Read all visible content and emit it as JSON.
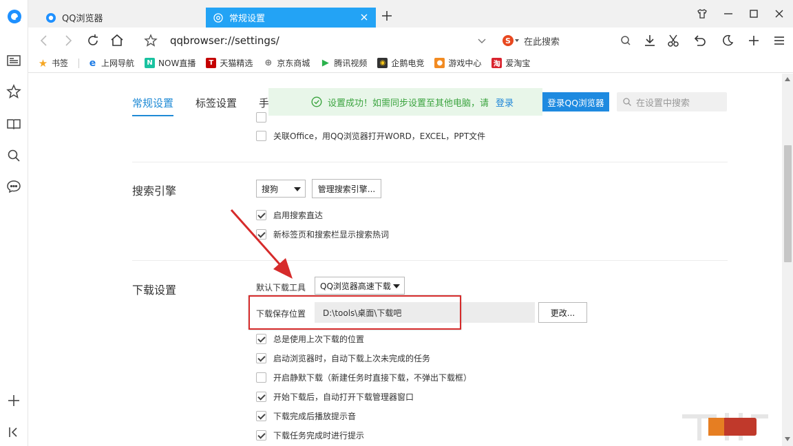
{
  "tabs": {
    "inactive": {
      "title": "QQ浏览器"
    },
    "active": {
      "title": "常规设置"
    }
  },
  "toolbar": {
    "url": "qqbrowser://settings/",
    "search_placeholder": "在此搜索"
  },
  "bookmarks": [
    {
      "label": "书签",
      "icon": "star-icon",
      "color": "#f5a623"
    },
    {
      "label": "上网导航",
      "icon": "ie-e-icon",
      "color": "#1d7be5"
    },
    {
      "label": "NOW直播",
      "icon": "now-icon",
      "color": "#19c2a0"
    },
    {
      "label": "天猫精选",
      "icon": "tmall-icon",
      "color": "#c40000"
    },
    {
      "label": "京东商城",
      "icon": "globe-icon",
      "color": "#777777"
    },
    {
      "label": "腾讯视频",
      "icon": "play-icon",
      "color": "#2bb24c"
    },
    {
      "label": "企鹅电竞",
      "icon": "penguin-icon",
      "color": "#333333"
    },
    {
      "label": "游戏中心",
      "icon": "gamepad-icon",
      "color": "#f28b22"
    },
    {
      "label": "爱淘宝",
      "icon": "taobao-icon",
      "color": "#d9232e"
    }
  ],
  "settings": {
    "tabs": [
      "常规设置",
      "标签设置",
      "手"
    ],
    "toast": {
      "message": "设置成功！如需同步设置至其他电脑，请",
      "link": "登录"
    },
    "login_button": "登录QQ浏览器",
    "search_placeholder": "在设置中搜索",
    "office_option": "关联Office，用QQ浏览器打开WORD，EXCEL，PPT文件",
    "search_engine": {
      "title": "搜索引擎",
      "selected": "搜狗",
      "manage_button": "管理搜索引擎...",
      "options": [
        "启用搜索直达",
        "新标签页和搜索栏显示搜索热词"
      ]
    },
    "download": {
      "title": "下载设置",
      "default_tool_label": "默认下载工具",
      "default_tool_value": "QQ浏览器高速下载",
      "save_location_label": "下载保存位置",
      "save_location_value": "D:\\tools\\桌面\\下载吧",
      "change_button": "更改...",
      "options": [
        {
          "label": "总是使用上次下载的位置",
          "checked": true
        },
        {
          "label": "启动浏览器时，自动下载上次未完成的任务",
          "checked": true
        },
        {
          "label": "开启静默下载（新建任务时直接下载，不弹出下载框）",
          "checked": false
        },
        {
          "label": "开始下载后，自动打开下载管理器窗口",
          "checked": true
        },
        {
          "label": "下载完成后播放提示音",
          "checked": true
        },
        {
          "label": "下载任务完成时进行提示",
          "checked": true
        }
      ]
    }
  },
  "colors": {
    "accent": "#23a3f5",
    "highlight": "#d62b2b",
    "success": "#3ba43f"
  }
}
